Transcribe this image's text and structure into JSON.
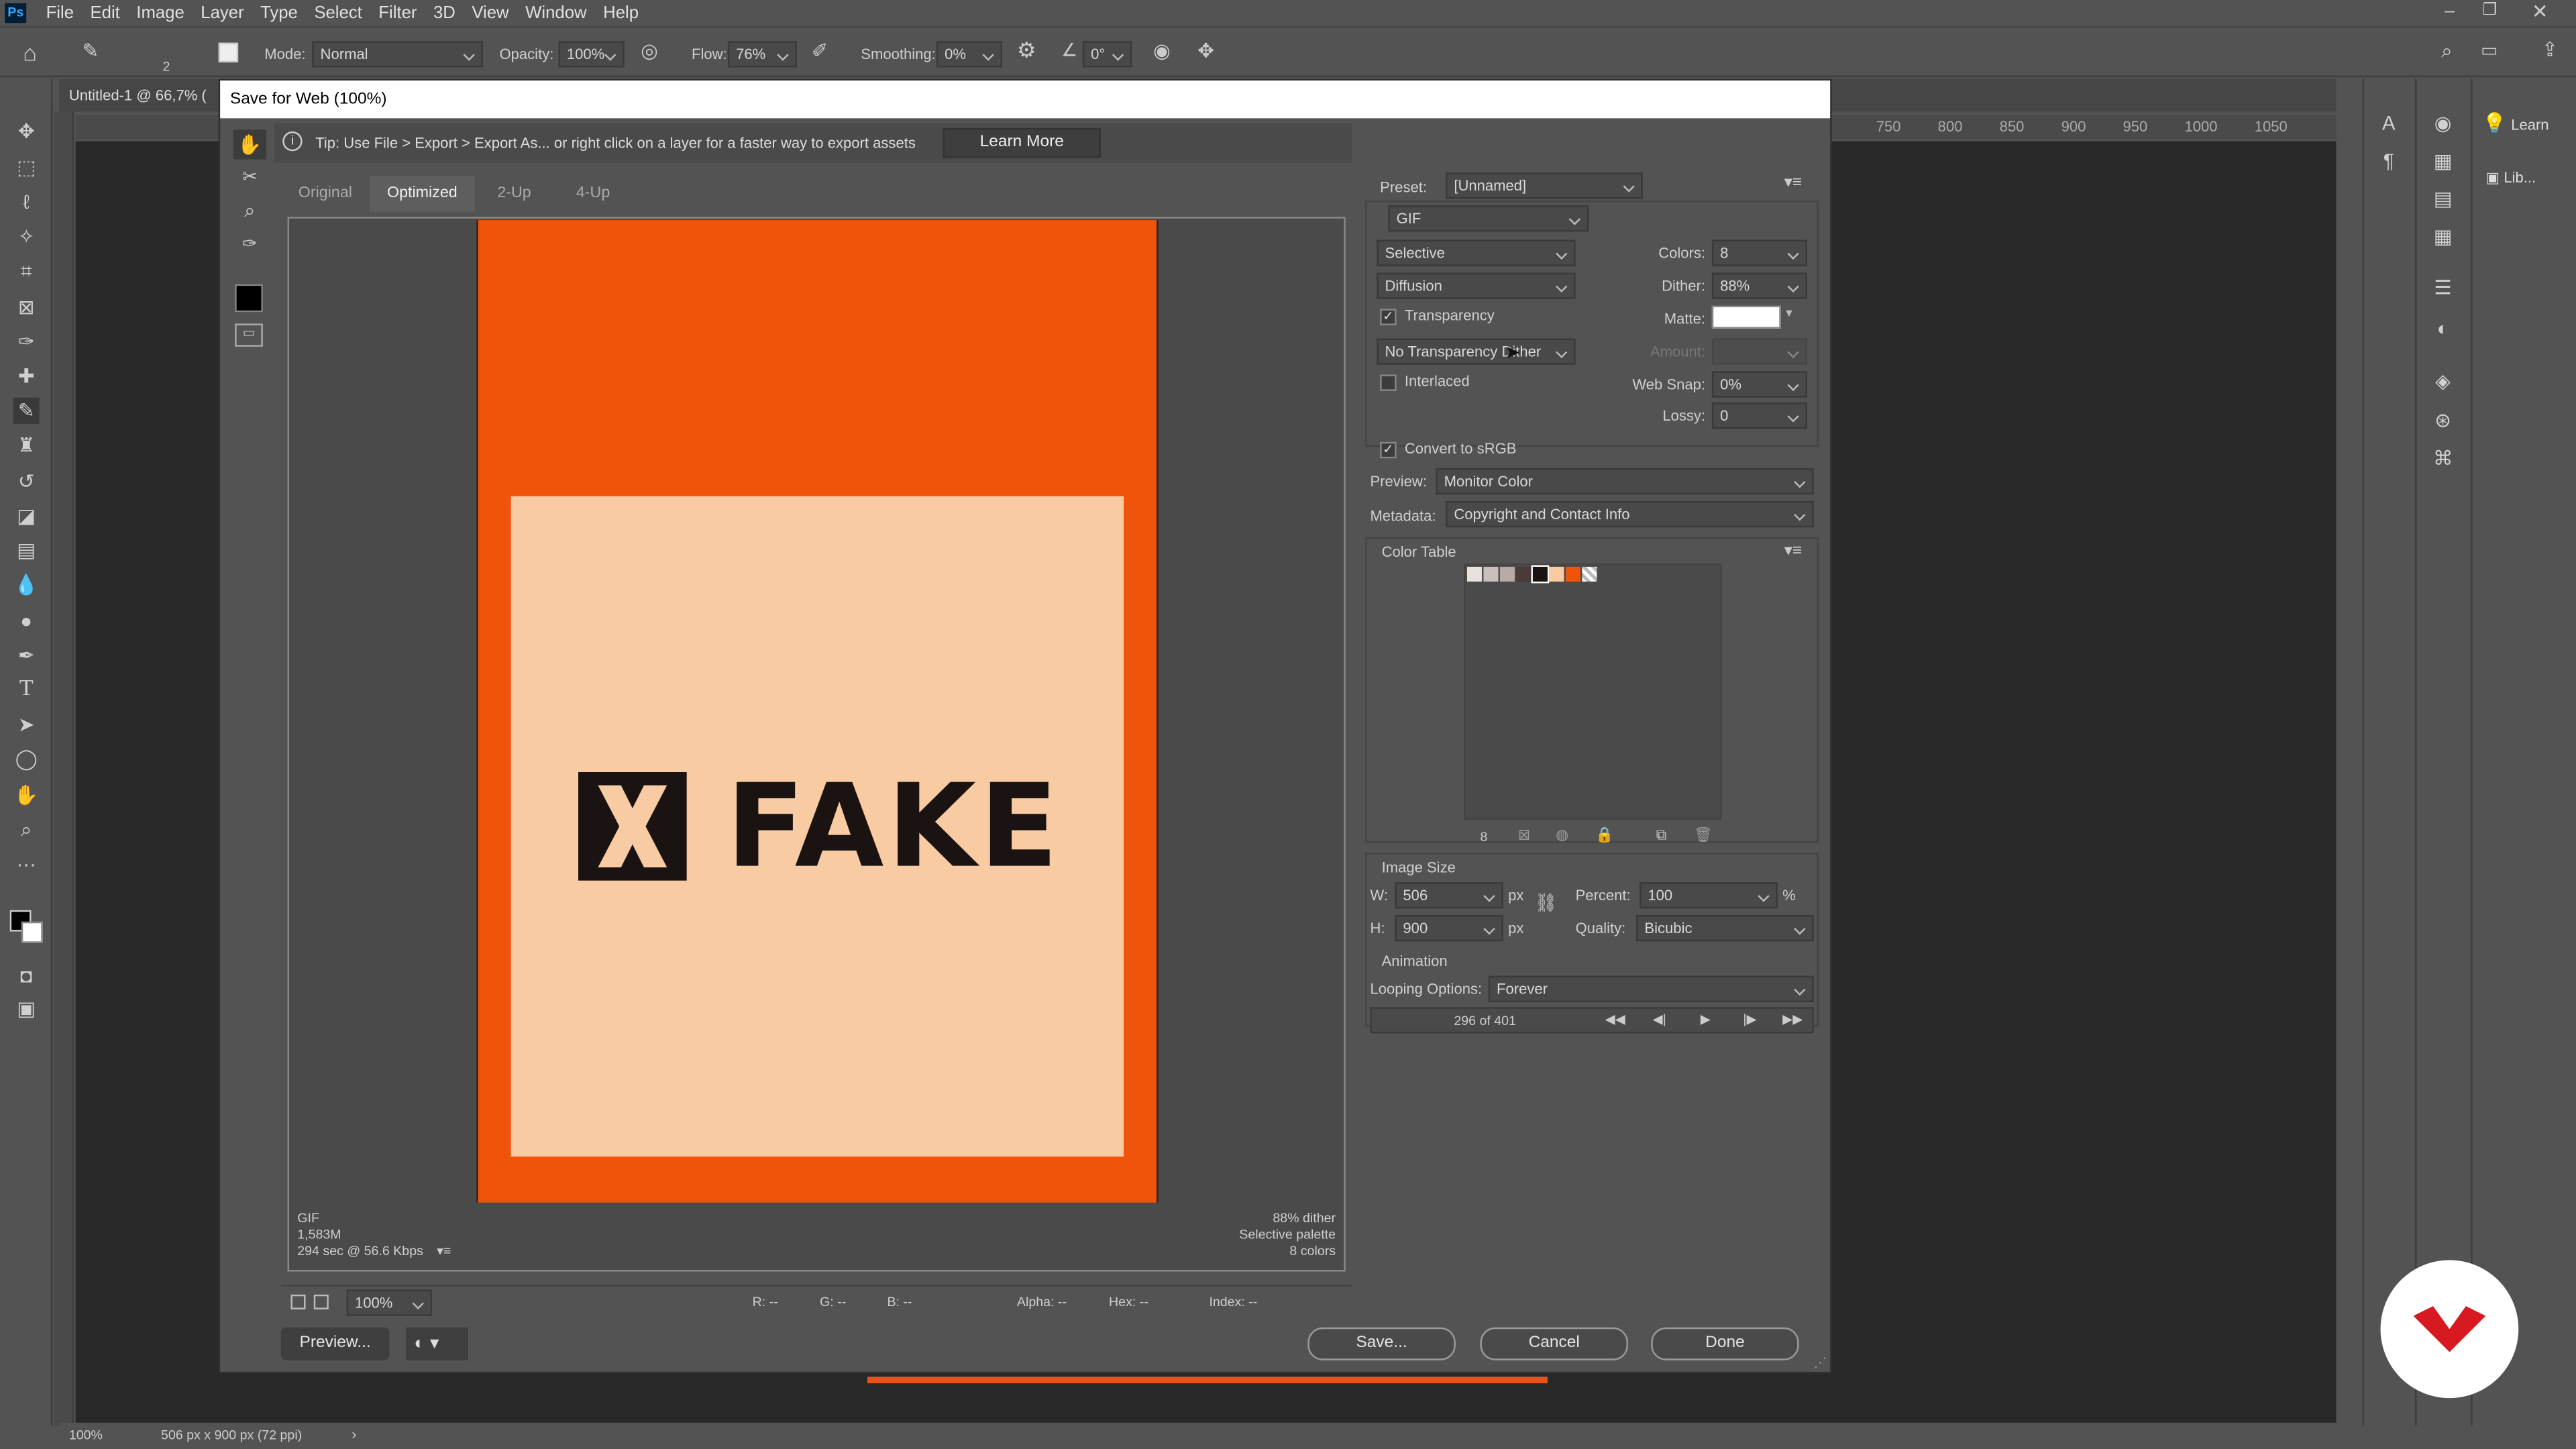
{
  "menubar": {
    "app_logo": "Ps",
    "items": [
      "File",
      "Edit",
      "Image",
      "Layer",
      "Type",
      "Select",
      "Filter",
      "3D",
      "View",
      "Window",
      "Help"
    ]
  },
  "options_bar": {
    "brush_size": "2",
    "mode_label": "Mode:",
    "mode_value": "Normal",
    "opacity_label": "Opacity:",
    "opacity_value": "100%",
    "flow_label": "Flow:",
    "flow_value": "76%",
    "smoothing_label": "Smoothing:",
    "smoothing_value": "0%",
    "angle_value": "0°"
  },
  "document_tab": "Untitled-1 @ 66,7% (",
  "ruler": {
    "numbers": [
      "750",
      "800",
      "850",
      "900",
      "950",
      "1000",
      "1050"
    ]
  },
  "dialog": {
    "title": "Save for Web (100%)",
    "tip_text": "Tip: Use File > Export > Export As...  or right click on a layer for a faster way to export assets",
    "learn_more": "Learn More",
    "tabs": [
      "Original",
      "Optimized",
      "2-Up",
      "4-Up"
    ],
    "active_tab": "Optimized",
    "artwork": {
      "logo_text": "FAKE",
      "bg_color": "#f0540a",
      "card_color": "#f8cba3",
      "ink_color": "#1a1311"
    },
    "preview_info": {
      "format": "GIF",
      "size": "1,583M",
      "time": "294 sec @ 56.6 Kbps",
      "dither": "88% dither",
      "palette": "Selective palette",
      "colors": "8 colors"
    },
    "status": {
      "zoom": "100%",
      "r": "R: --",
      "g": "G: --",
      "b": "B: --",
      "alpha": "Alpha: --",
      "hex": "Hex: --",
      "index": "Index: --"
    },
    "buttons": {
      "preview": "Preview...",
      "save": "Save...",
      "cancel": "Cancel",
      "done": "Done"
    },
    "settings": {
      "preset_label": "Preset:",
      "preset_value": "[Unnamed]",
      "format": "GIF",
      "reduction": "Selective",
      "dither_algo": "Diffusion",
      "transparency_label": "Transparency",
      "transparency_checked": true,
      "transparency_dither": "No Transparency Dither",
      "interlaced_label": "Interlaced",
      "interlaced_checked": false,
      "colors_label": "Colors:",
      "colors_value": "8",
      "dither_label": "Dither:",
      "dither_value": "88%",
      "matte_label": "Matte:",
      "amount_label": "Amount:",
      "websnap_label": "Web Snap:",
      "websnap_value": "0%",
      "lossy_label": "Lossy:",
      "lossy_value": "0",
      "convert_label": "Convert to sRGB",
      "convert_checked": true,
      "preview_label": "Preview:",
      "preview_value": "Monitor Color",
      "metadata_label": "Metadata:",
      "metadata_value": "Copyright and Contact Info"
    },
    "color_table": {
      "title": "Color Table",
      "swatches": [
        "#e8e2df",
        "#c9c0bd",
        "#b7aaa7",
        "#4a3a38",
        "#1a1311",
        "#f8cba3",
        "#f0540a",
        "#ffffff"
      ],
      "count": "8"
    },
    "image_size": {
      "title": "Image Size",
      "w_label": "W:",
      "w_value": "506",
      "h_label": "H:",
      "h_value": "900",
      "unit": "px",
      "percent_label": "Percent:",
      "percent_value": "100",
      "percent_unit": "%",
      "quality_label": "Quality:",
      "quality_value": "Bicubic"
    },
    "animation": {
      "title": "Animation",
      "looping_label": "Looping Options:",
      "looping_value": "Forever",
      "frame": "296 of 401"
    }
  },
  "bottom_status": {
    "zoom": "100%",
    "doc_info": "506 px x 900 px (72 ppi)"
  },
  "right_panel": {
    "learn": "Learn",
    "libraries": "Lib..."
  }
}
